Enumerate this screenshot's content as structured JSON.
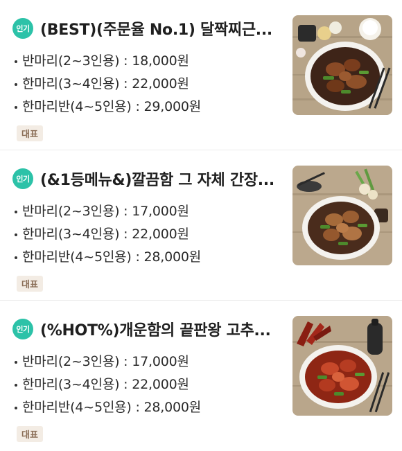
{
  "menu": {
    "items": [
      {
        "badge": "인기",
        "title": "(BEST)(주문율 No.1) 달짝찌근...",
        "options": [
          "반마리(2~3인용) : 18,000원",
          "한마리(3~4인용) : 22,000원",
          "한마리반(4~5인용) : 29,000원"
        ],
        "tag": "대표",
        "image_icon": "braised-chicken-photo"
      },
      {
        "badge": "인기",
        "title": "(&1등메뉴&)깔끔함 그 자체 간장...",
        "options": [
          "반마리(2~3인용) : 17,000원",
          "한마리(3~4인용) : 22,000원",
          "한마리반(4~5인용) : 28,000원"
        ],
        "tag": "대표",
        "image_icon": "soy-braised-chicken-photo"
      },
      {
        "badge": "인기",
        "title": "(%HOT%)개운함의 끝판왕 고추...",
        "options": [
          "반마리(2~3인용) : 17,000원",
          "한마리(3~4인용) : 22,000원",
          "한마리반(4~5인용) : 28,000원"
        ],
        "tag": "대표",
        "image_icon": "spicy-chili-chicken-photo"
      }
    ]
  },
  "colors": {
    "badge_bg": "#2cc2a8",
    "tag_bg": "#f3ece4",
    "tag_text": "#8a6d56",
    "wood_bg": "#b9a58a"
  }
}
